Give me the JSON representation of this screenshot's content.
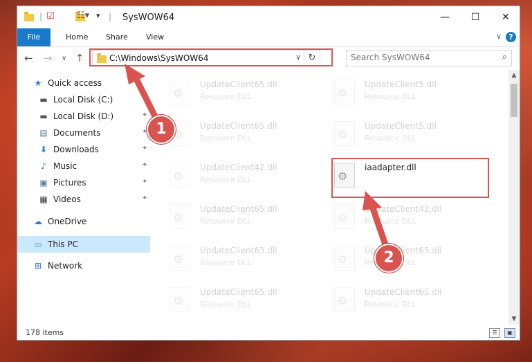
{
  "window": {
    "title": "SysWOW64",
    "minimize_icon": "minimize-icon",
    "maximize_icon": "maximize-icon",
    "close_icon": "close-icon"
  },
  "ribbon": {
    "tabs": [
      "File",
      "Home",
      "Share",
      "View"
    ],
    "help_label": "?"
  },
  "nav": {
    "address_path": "C:\\Windows\\SysWOW64",
    "search_placeholder": "Search SysWOW64"
  },
  "sidebar": {
    "items": [
      {
        "label": "Quick access",
        "icon": "star-icon"
      },
      {
        "label": "Local Disk (C:)",
        "icon": "drive-icon"
      },
      {
        "label": "Local Disk (D:)",
        "icon": "drive-icon"
      },
      {
        "label": "Documents",
        "icon": "documents-icon"
      },
      {
        "label": "Downloads",
        "icon": "download-icon"
      },
      {
        "label": "Music",
        "icon": "music-icon"
      },
      {
        "label": "Pictures",
        "icon": "pictures-icon"
      },
      {
        "label": "Videos",
        "icon": "videos-icon"
      },
      {
        "label": "OneDrive",
        "icon": "cloud-icon"
      },
      {
        "label": "This PC",
        "icon": "computer-icon"
      },
      {
        "label": "Network",
        "icon": "network-icon"
      }
    ]
  },
  "files": [
    {
      "name": "UpdateClient65.dll",
      "type": "Resource DLL"
    },
    {
      "name": "UpdateClient5.dll",
      "type": "Resource DLL"
    },
    {
      "name": "UpdateClient65.dll",
      "type": "Resource DLL"
    },
    {
      "name": "UpdateClient5.dll",
      "type": "Resource DLL"
    },
    {
      "name": "UpdateClient42.dll",
      "type": "Resource DLL"
    },
    {
      "name": "iaadapter.dll",
      "type": ""
    },
    {
      "name": "UpdateClient65.dll",
      "type": "Resource DLL"
    },
    {
      "name": "UpdateClient42.dll",
      "type": "Resource DLL"
    },
    {
      "name": "UpdateClient63.dll",
      "type": "Resource DLL"
    },
    {
      "name": "UpdateClient65.dll",
      "type": "Resource DLL"
    },
    {
      "name": "UpdateClient65.dll",
      "type": "Resource DLL"
    },
    {
      "name": "UpdateClient65.dll",
      "type": "Resource DLL"
    }
  ],
  "status": {
    "item_count": "178 items"
  },
  "annotations": {
    "step1": "1",
    "step2": "2",
    "color": "#d9534f"
  }
}
